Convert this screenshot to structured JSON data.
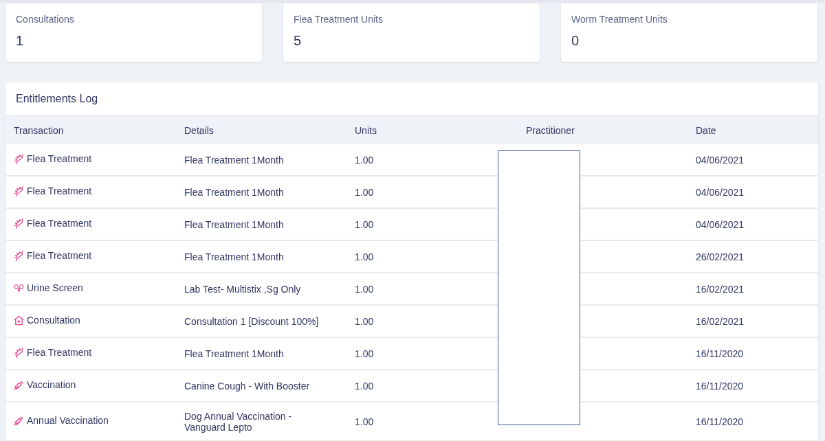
{
  "summary_cards": [
    {
      "label": "Consultations",
      "value": "1"
    },
    {
      "label": "Flea Treatment Units",
      "value": "5"
    },
    {
      "label": "Worm Treatment Units",
      "value": "0"
    }
  ],
  "entitlements_log": {
    "title": "Entitlements Log",
    "columns": [
      "Transaction",
      "Details",
      "Units",
      "Practitioner",
      "Date"
    ],
    "rows": [
      {
        "kind": "flea",
        "transaction": "Flea Treatment",
        "details": "Flea Treatment 1Month",
        "units": "1.00",
        "date": "04/06/2021"
      },
      {
        "kind": "flea",
        "transaction": "Flea Treatment",
        "details": "Flea Treatment 1Month",
        "units": "1.00",
        "date": "04/06/2021"
      },
      {
        "kind": "flea",
        "transaction": "Flea Treatment",
        "details": "Flea Treatment 1Month",
        "units": "1.00",
        "date": "04/06/2021"
      },
      {
        "kind": "flea",
        "transaction": "Flea Treatment",
        "details": "Flea Treatment 1Month",
        "units": "1.00",
        "date": "26/02/2021"
      },
      {
        "kind": "urine",
        "transaction": "Urine Screen",
        "details": "Lab Test- Multistix ,Sg Only",
        "units": "1.00",
        "date": "16/02/2021"
      },
      {
        "kind": "consultation",
        "transaction": "Consultation",
        "details": "Consultation 1 [Discount 100%]",
        "units": "1.00",
        "date": "16/02/2021"
      },
      {
        "kind": "flea",
        "transaction": "Flea Treatment",
        "details": "Flea Treatment 1Month",
        "units": "1.00",
        "date": "16/11/2020"
      },
      {
        "kind": "vaccination",
        "transaction": "Vaccination",
        "details": "Canine Cough - With Booster",
        "units": "1.00",
        "date": "16/11/2020"
      },
      {
        "kind": "vaccination",
        "transaction": "Annual Vaccination",
        "details": "Dog Annual Vaccination - Vanguard Lepto",
        "units": "1.00",
        "date": "16/11/2020"
      }
    ]
  }
}
